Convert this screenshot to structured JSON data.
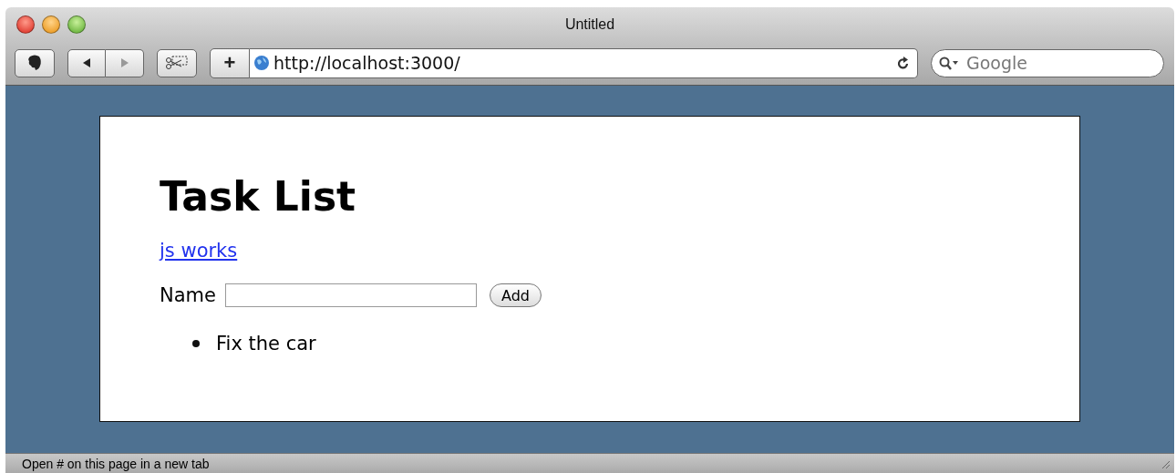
{
  "window": {
    "title": "Untitled"
  },
  "toolbar": {
    "url": "http://localhost:3000/",
    "search": {
      "placeholder": "Google"
    },
    "add_tab_button": "+"
  },
  "page": {
    "heading": "Task List",
    "link": "js works",
    "form": {
      "label": "Name",
      "button": "Add"
    },
    "tasks": [
      "Fix the car"
    ]
  },
  "status_bar": "Open # on this page in a new tab"
}
